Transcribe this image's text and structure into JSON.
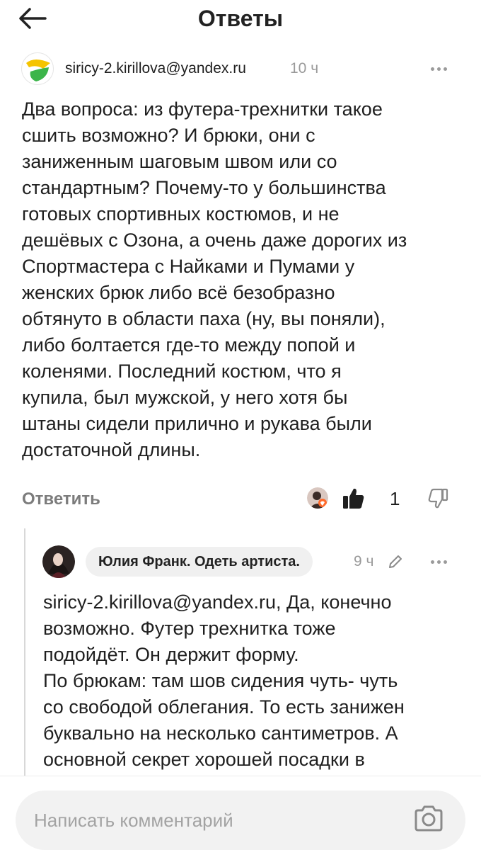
{
  "header": {
    "title": "Ответы",
    "back_icon": "arrow-left-icon"
  },
  "comment": {
    "author": "siricy-2.kirillova@yandex.ru",
    "time": "10 ч",
    "text": "Два вопроса: из футера-трехнитки такое\nсшить возможно? И брюки, они с\nзаниженным шаговым швом или со\nстандартным? Почему-то у большинства\nготовых спортивных костюмов, и не\nдешёвых с Озона, а очень даже дорогих из\nСпортмастера с Найками и Пумами у\nженских брюк либо всё безобразно\nобтянуто в области паха (ну, вы поняли),\nлибо болтается где-то между попой и\nколенями. Последний костюм,  что я\nкупила,  был мужской, у него хотя бы\nштаны сидели прилично и рукава были\nдостаточной длины.",
    "reply_label": "Ответить",
    "likes": "1",
    "brand_colors": {
      "yellow": "#f5c400",
      "green": "#3cb54a"
    }
  },
  "reply": {
    "author": "Юлия Франк. Одеть артиста.",
    "time": "9 ч",
    "text": "siricy-2.kirillova@yandex.ru, Да, конечно\nвозможно. Футер трехнитка тоже\nподойдёт. Он держит форму.\nПо брюкам: там шов сидения чуть- чуть\nсо свободой облегания. То есть занижен\nбуквально на несколько сантиметров. А\nосновной секрет хорошей посадки в"
  },
  "composer": {
    "placeholder": "Написать комментарий",
    "camera_icon": "camera-icon"
  }
}
